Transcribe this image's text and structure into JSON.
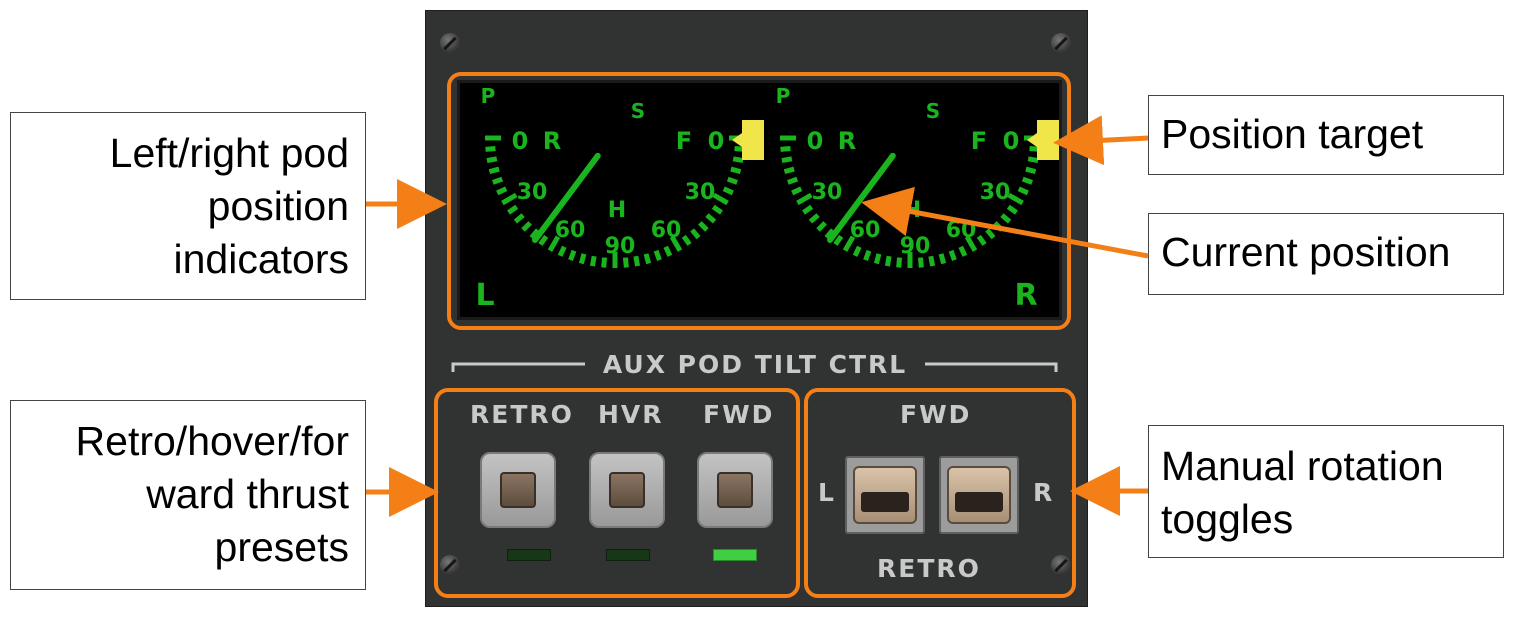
{
  "callouts": {
    "pod_indicators": [
      "Left/right pod",
      "position",
      "indicators"
    ],
    "position_target": "Position target",
    "current_position": "Current position",
    "thrust_presets": [
      "Retro/hover/for",
      "ward thrust",
      "presets"
    ],
    "manual_toggles": [
      "Manual rotation",
      "toggles"
    ]
  },
  "panel": {
    "title": "AUX POD TILT CTRL",
    "preset_labels": [
      "RETRO",
      "HVR",
      "FWD"
    ],
    "preset_indicators_on": [
      false,
      false,
      true
    ],
    "toggle_top_label": "FWD",
    "toggle_bottom_label": "RETRO",
    "toggle_left": "L",
    "toggle_right": "R"
  },
  "gauges": {
    "top_labels": [
      "P",
      "S"
    ],
    "scale_labels": [
      "0",
      "R",
      "30",
      "60",
      "90",
      "60",
      "30",
      "F",
      "0",
      "H"
    ],
    "left_side_label": "L",
    "right_side_label": "R"
  },
  "colors": {
    "accent_orange": "#f57f17",
    "gauge_green": "#19b41e",
    "target_yellow": "#f0e64a",
    "panel_bg": "#313232"
  }
}
